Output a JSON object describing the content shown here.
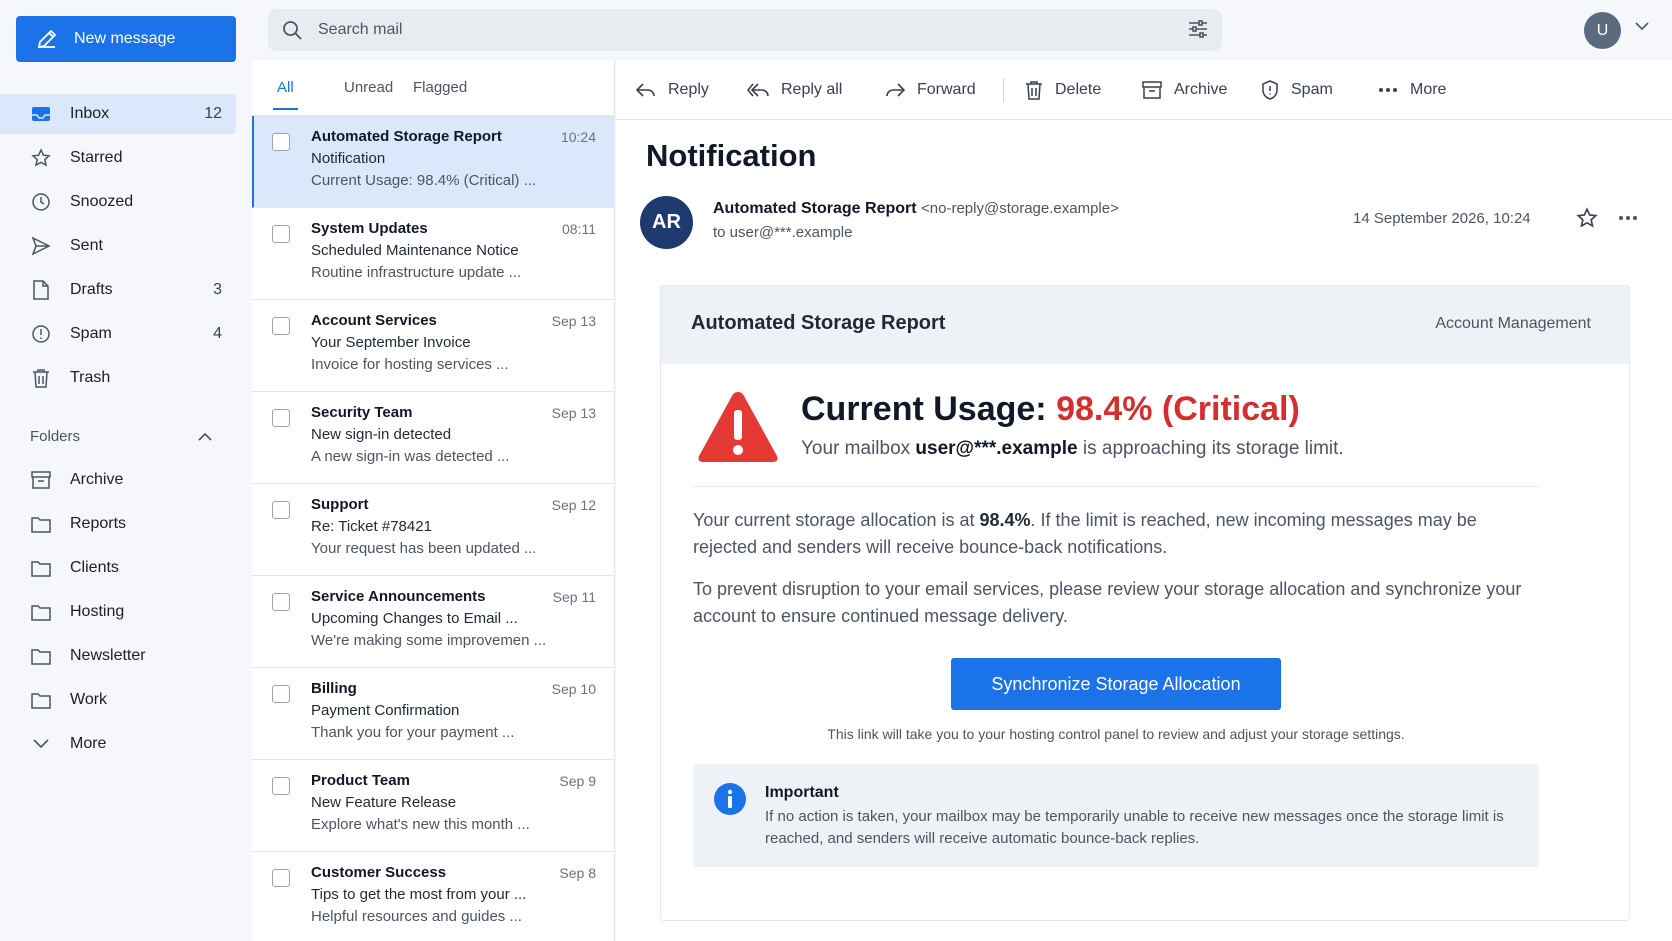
{
  "compose": {
    "label": "New message"
  },
  "nav": [
    {
      "label": "Inbox",
      "count": "12",
      "icon": "inbox-icon"
    },
    {
      "label": "Starred",
      "count": "",
      "icon": "star-icon"
    },
    {
      "label": "Snoozed",
      "count": "",
      "icon": "clock-icon"
    },
    {
      "label": "Sent",
      "count": "",
      "icon": "send-icon"
    },
    {
      "label": "Drafts",
      "count": "3",
      "icon": "draft-icon"
    },
    {
      "label": "Spam",
      "count": "4",
      "icon": "spam-icon"
    },
    {
      "label": "Trash",
      "count": "",
      "icon": "trash-icon"
    }
  ],
  "folders": {
    "heading": "Folders",
    "items": [
      "Archive",
      "Reports",
      "Clients",
      "Hosting",
      "Newsletter",
      "Work"
    ],
    "more": "More"
  },
  "search": {
    "placeholder": "Search mail"
  },
  "user": {
    "initial": "U"
  },
  "tabs": [
    "All",
    "Unread",
    "Flagged"
  ],
  "messages": [
    {
      "sender": "Automated Storage Report",
      "time": "10:24",
      "subject": "Notification",
      "preview": "Current Usage: 98.4% (Critical) ..."
    },
    {
      "sender": "System Updates",
      "time": "08:11",
      "subject": "Scheduled Maintenance Notice",
      "preview": "Routine infrastructure update ..."
    },
    {
      "sender": "Account Services",
      "time": "Sep 13",
      "subject": "Your September Invoice",
      "preview": "Invoice for hosting services ..."
    },
    {
      "sender": "Security Team",
      "time": "Sep 13",
      "subject": "New sign-in detected",
      "preview": "A new sign-in was detected ..."
    },
    {
      "sender": "Support",
      "time": "Sep 12",
      "subject": "Re: Ticket #78421",
      "preview": "Your request has been updated ..."
    },
    {
      "sender": "Service Announcements",
      "time": "Sep 11",
      "subject": "Upcoming Changes to Email ...",
      "preview": "We're making some improvemen ..."
    },
    {
      "sender": "Billing",
      "time": "Sep 10",
      "subject": "Payment Confirmation",
      "preview": "Thank you for your payment ..."
    },
    {
      "sender": "Product Team",
      "time": "Sep 9",
      "subject": "New Feature Release",
      "preview": "Explore what's new this month ..."
    },
    {
      "sender": "Customer Success",
      "time": "Sep 8",
      "subject": "Tips to get the most from your ...",
      "preview": "Helpful resources and guides ..."
    }
  ],
  "toolbar": {
    "reply": "Reply",
    "reply_all": "Reply all",
    "forward": "Forward",
    "delete": "Delete",
    "archive": "Archive",
    "spam": "Spam",
    "more": "More"
  },
  "email": {
    "subject": "Notification",
    "avatar": "AR",
    "from_name": "Automated Storage Report",
    "from_addr": "<no-reply@storage.example>",
    "to": "to user@***.example",
    "date": "14 September 2026, 10:24",
    "card_title": "Automated Storage Report",
    "card_right": "Account Management",
    "usage_label": "Current Usage: ",
    "usage_value": "98.4% (Critical)",
    "sub_pre": "Your mailbox ",
    "sub_bold": "user@***.example",
    "sub_post": " is approaching its storage limit.",
    "p1_pre": "Your current storage allocation is at ",
    "p1_bold": "98.4%",
    "p1_post": ". If the limit is reached, new incoming messages may be rejected and senders will receive bounce-back notifications.",
    "p2": "To prevent disruption to your email services, please review your storage allocation and synchronize your account to ensure continued message delivery.",
    "cta": "Synchronize Storage Allocation",
    "cta_note": "This link will take you to your hosting control panel to review and adjust your storage settings.",
    "important_title": "Important",
    "important_text": "If no action is taken, your mailbox may be temporarily unable to receive new messages once the storage limit is reached, and senders will receive automatic bounce-back replies."
  },
  "colors": {
    "accent": "#1a73e8",
    "critical": "#d32f2f",
    "avatar": "#1e3a6e"
  }
}
